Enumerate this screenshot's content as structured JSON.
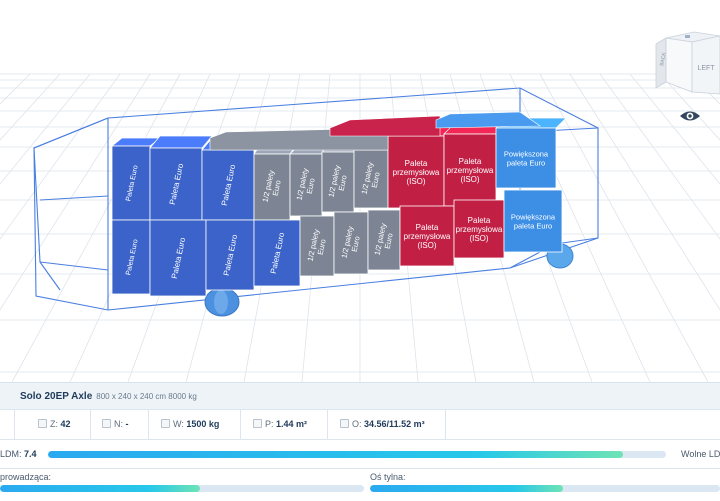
{
  "viewcube": {
    "face_left": "LEFT",
    "face_side": "BACK"
  },
  "pallets": {
    "euro": "Paleta Euro",
    "half": "1/2 palety Euro",
    "industrial": "Paleta przemysłowa (ISO)",
    "enlarged": "Powiększona paleta Euro"
  },
  "vehicle": {
    "name": "Solo 20EP Axle",
    "specs": "800 x 240 x 240 cm 8000 kg"
  },
  "stats": {
    "z_label": "Z:",
    "z_value": "42",
    "n_label": "N:",
    "n_value": "-",
    "w_label": "W:",
    "w_value": "1500 kg",
    "p_label": "P:",
    "p_value": "1.44 m²",
    "o_label": "O:",
    "o_value": "34.56/11.52 m³"
  },
  "ldm": {
    "label": "LDM:",
    "value": "7.4",
    "fill_fraction": 0.93,
    "free_label": "Wolne LD"
  },
  "axles": {
    "front_label": "prowadząca:",
    "front_fill_fraction": 0.55,
    "rear_label": "Oś tylna:",
    "rear_fill_fraction": 0.55
  },
  "colors": {
    "euro_pallet": "#3b63c9",
    "half_pallet": "#7d8594",
    "industrial_pallet": "#c21f45",
    "enlarged_pallet": "#3d8fe6",
    "outline": "#4a7fe0",
    "bar_fill": "#2aa9f0"
  }
}
